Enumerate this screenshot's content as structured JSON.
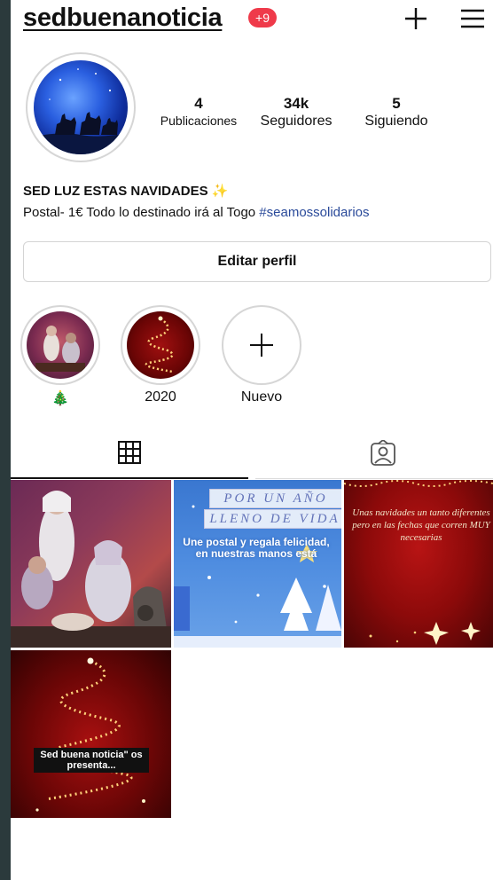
{
  "profile": {
    "username": "sedbuenanoticia",
    "notification_badge": "+9",
    "stats": [
      {
        "value": "4",
        "label": "Publicaciones"
      },
      {
        "value": "34k",
        "label": "Seguidores"
      },
      {
        "value": "5",
        "label": "Siguiendo"
      }
    ],
    "bio_name": "SED LUZ ESTAS NAVIDADES",
    "bio_sparkle": "✨",
    "bio_text": "Postal- 1€ Todo lo destinado irá al Togo ",
    "bio_hashtag": "#seamossolidarios",
    "edit_button_label": "Editar perfil"
  },
  "highlights": [
    {
      "label": "🎄",
      "icon": "nativity-scene"
    },
    {
      "label": "2020",
      "icon": "christmas-tree-lights"
    },
    {
      "label": "Nuevo",
      "icon": "plus-icon"
    }
  ],
  "tabs": [
    {
      "name": "grid",
      "icon": "grid-icon",
      "active": true
    },
    {
      "name": "tagged",
      "icon": "tagged-person-icon",
      "active": false
    }
  ],
  "posts": [
    {
      "kind": "photo",
      "subject": "nativity-scene-costumes"
    },
    {
      "kind": "graphic",
      "banner_1": "POR UN AÑO",
      "banner_2": "LLENO DE VIDA",
      "caption": "Une postal y regala felicidad, en nuestras manos está"
    },
    {
      "kind": "graphic",
      "caption": "Unas navidades un tanto diferentes pero en las fechas que corren MUY necesarias"
    },
    {
      "kind": "graphic",
      "caption": "Sed buena noticia\" os presenta..."
    }
  ],
  "colors": {
    "background": "#ffffff",
    "frame": "#2b3a3c",
    "badge": "#ef3a4a",
    "hashtag": "#2a4a9a",
    "text": "#111111"
  }
}
